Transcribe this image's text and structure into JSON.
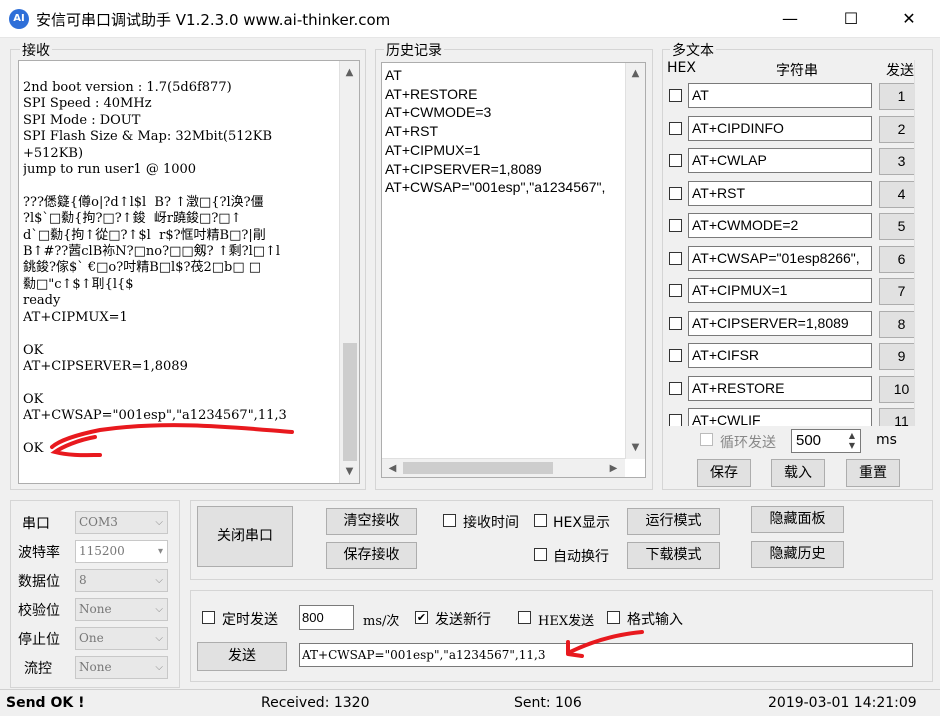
{
  "window": {
    "title": "安信可串口调试助手 V1.2.3.0    www.ai-thinker.com",
    "icon_text": "AI",
    "minimize": "—",
    "maximize": "☐",
    "close": "✕"
  },
  "receive": {
    "label": "接收",
    "text": "2nd boot version : 1.7(5d6f877)\nSPI Speed : 40MHz\nSPI Mode : DOUT\nSPI Flash Size & Map: 32Mbit(512KB\n+512KB)\njump to run user1 @ 1000\n\n???僁籎{僔o|?d↑l$l  B? ↑澂□{?l涣?僵\n?l$`□勬{拘?□?↑鋑  岈r蹺鋑□?□↑\nd`□勬{拘↑從□?↑$l  r$?恇吋精B□?|剈\nB↑#??蒏clB袮N?□no?□□剱? ↑剩?l□↑l\n銚鋑?傢$` €□o?吋精B□l$?茷2□b□ □\n勬□\"c↑$↑刵{l{$\nready\nAT+CIPMUX=1\n\nOK\nAT+CIPSERVER=1,8089\n\nOK\nAT+CWSAP=\"001esp\",\"a1234567\",11,3\n\nOK"
  },
  "history": {
    "label": "历史记录",
    "items": [
      "AT",
      "AT+RESTORE",
      "AT+CWMODE=3",
      "AT+RST",
      "AT+CIPMUX=1",
      "AT+CIPSERVER=1,8089",
      "AT+CWSAP=\"001esp\",\"a1234567\","
    ]
  },
  "multi": {
    "label": "多文本",
    "col_hex": "HEX",
    "col_string": "字符串",
    "col_send": "发送",
    "rows": [
      {
        "text": "AT",
        "num": "1"
      },
      {
        "text": "AT+CIPDINFO",
        "num": "2"
      },
      {
        "text": "AT+CWLAP",
        "num": "3"
      },
      {
        "text": "AT+RST",
        "num": "4"
      },
      {
        "text": "AT+CWMODE=2",
        "num": "5"
      },
      {
        "text": "AT+CWSAP=\"01esp8266\",",
        "num": "6"
      },
      {
        "text": "AT+CIPMUX=1",
        "num": "7"
      },
      {
        "text": "AT+CIPSERVER=1,8089",
        "num": "8"
      },
      {
        "text": "AT+CIFSR",
        "num": "9"
      },
      {
        "text": "AT+RESTORE",
        "num": "10"
      },
      {
        "text": "AT+CWLIF",
        "num": "11"
      }
    ],
    "loop_label": "循环发送",
    "loop_value": "500",
    "loop_unit": "ms",
    "save": "保存",
    "load": "载入",
    "reset": "重置"
  },
  "serial": {
    "port_label": "串口",
    "port_value": "COM3",
    "baud_label": "波特率",
    "baud_value": "115200",
    "databits_label": "数据位",
    "databits_value": "8",
    "parity_label": "校验位",
    "parity_value": "None",
    "stopbits_label": "停止位",
    "stopbits_value": "One",
    "flow_label": "流控",
    "flow_value": "None"
  },
  "controls": {
    "close_port": "关闭串口",
    "clear_recv": "清空接收",
    "save_recv": "保存接收",
    "recv_time": "接收时间",
    "hex_display": "HEX显示",
    "run_mode": "运行模式",
    "hide_panel": "隐藏面板",
    "auto_wrap": "自动换行",
    "download_mode": "下载模式",
    "hide_history": "隐藏历史"
  },
  "send": {
    "timed_send": "定时发送",
    "interval": "800",
    "interval_unit": "ms/次",
    "send_newline": "发送新行",
    "hex_send": "HEX发送",
    "format_input": "格式输入",
    "send_button": "发送",
    "input_value": "AT+CWSAP=\"001esp\",\"a1234567\",11,3"
  },
  "status": {
    "send_ok": "Send OK !",
    "received": "Received: 1320",
    "sent": "Sent: 106",
    "datetime": "2019-03-01 14:21:09"
  },
  "colors": {
    "annotation_red": "#e8191e",
    "accent": "#2f6fd8"
  }
}
